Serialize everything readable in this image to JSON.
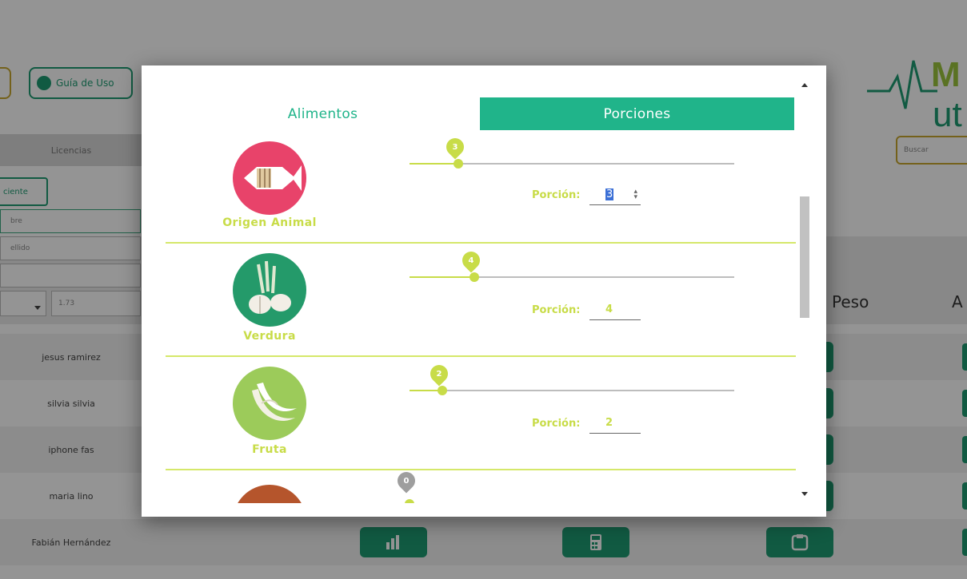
{
  "background": {
    "guide_button": "Guía de Uso",
    "licencias_tab": "Licencias",
    "paciente_button": "ciente",
    "side_inputs": [
      "bre",
      "ellido",
      ""
    ],
    "height_value": "1.73",
    "column_peso": "Peso",
    "column_a": "A",
    "logo_text": "ut",
    "search_placeholder": "Buscar",
    "rows": [
      {
        "name": "jesus ramirez"
      },
      {
        "name": "silvia silvia"
      },
      {
        "name": "iphone fas"
      },
      {
        "name": "maria lino"
      },
      {
        "name": "Fabián Hernández"
      }
    ],
    "colors": {
      "green": "#1e9c73",
      "gold": "#c8a830"
    }
  },
  "modal": {
    "tabs": [
      {
        "label": "Alimentos",
        "active": false
      },
      {
        "label": "Porciones",
        "active": true
      }
    ],
    "portion_label": "Porción:",
    "groups": [
      {
        "label": "Origen Animal",
        "value": 3,
        "max": 20,
        "icon": "fish-icon",
        "color": "#e8436a"
      },
      {
        "label": "Verdura",
        "value": 4,
        "max": 20,
        "icon": "vegetable-icon",
        "color": "#249a6a"
      },
      {
        "label": "Fruta",
        "value": 2,
        "max": 20,
        "icon": "banana-icon",
        "color": "#9ccb5a"
      },
      {
        "label": "",
        "value": 0,
        "max": 20,
        "icon": "bread-icon",
        "color": "#b5552c"
      }
    ],
    "colors": {
      "accent": "#20b48a",
      "lime": "#c8dc48"
    }
  }
}
